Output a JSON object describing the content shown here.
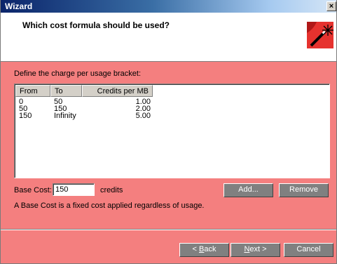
{
  "window": {
    "title": "Wizard",
    "close_glyph": "×"
  },
  "header": {
    "question": "Which cost formula should be used?",
    "icon": "magic-wand-icon"
  },
  "body": {
    "instruction": "Define the charge per usage bracket:",
    "columns": {
      "from": "From",
      "to": "To",
      "credits": "Credits per MB"
    },
    "rows": [
      {
        "from": "0",
        "to": "50",
        "credits": "1.00"
      },
      {
        "from": "50",
        "to": "150",
        "credits": "2.00"
      },
      {
        "from": "150",
        "to": "Infinity",
        "credits": "5.00"
      }
    ],
    "base_cost_label": "Base Cost:",
    "base_cost_value": "150",
    "credits_unit": "credits",
    "add_label": "Add...",
    "remove_label": "Remove",
    "note": "A Base Cost is a fixed cost applied regardless of usage."
  },
  "footer": {
    "back_prefix": "< ",
    "back_accel": "B",
    "back_rest": "ack",
    "next_accel": "N",
    "next_rest": "ext >",
    "cancel_label": "Cancel"
  },
  "colors": {
    "accent": "#f47f7f",
    "title_gradient_start": "#0a246a",
    "icon_bg": "#e6322e"
  }
}
